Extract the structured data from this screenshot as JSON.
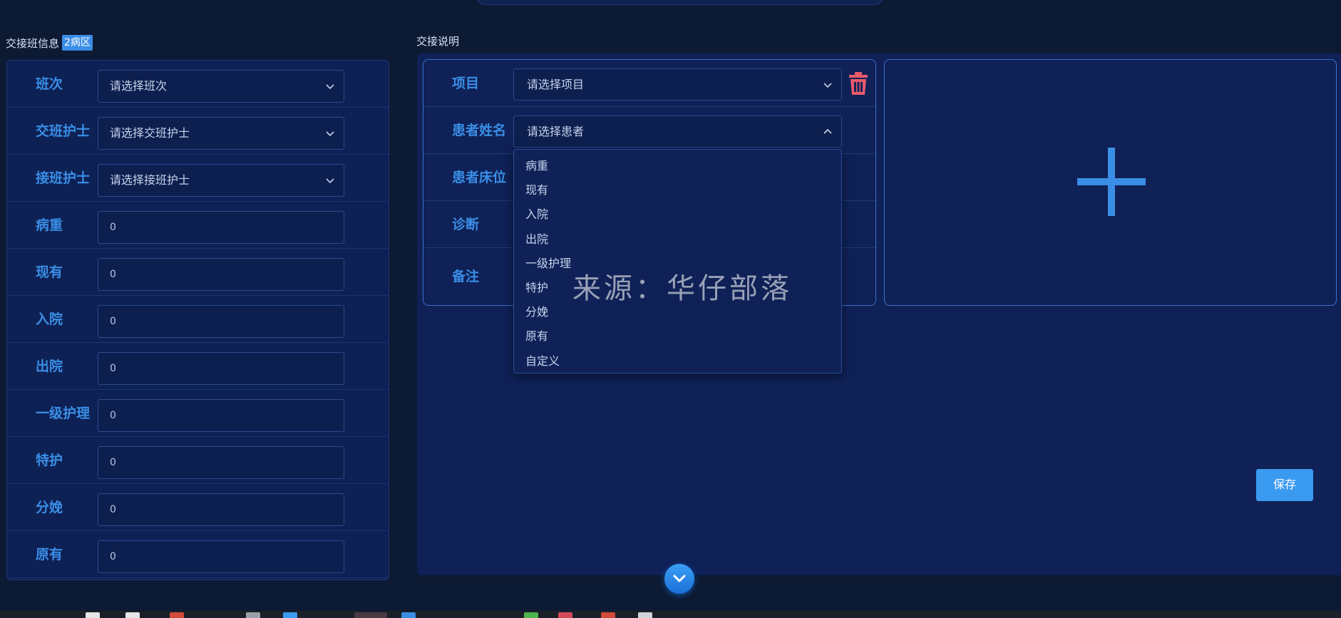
{
  "left": {
    "title": "交接班信息",
    "badge": "2病区",
    "rows": [
      {
        "label": "班次",
        "type": "select",
        "value": "请选择班次"
      },
      {
        "label": "交班护士",
        "type": "select",
        "value": "请选择交班护士"
      },
      {
        "label": "接班护士",
        "type": "select",
        "value": "请选择接班护士"
      },
      {
        "label": "病重",
        "type": "input",
        "value": "0"
      },
      {
        "label": "现有",
        "type": "input",
        "value": "0"
      },
      {
        "label": "入院",
        "type": "input",
        "value": "0"
      },
      {
        "label": "出院",
        "type": "input",
        "value": "0"
      },
      {
        "label": "一级护理",
        "type": "input",
        "value": "0"
      },
      {
        "label": "特护",
        "type": "input",
        "value": "0"
      },
      {
        "label": "分娩",
        "type": "input",
        "value": "0"
      },
      {
        "label": "原有",
        "type": "input",
        "value": "0"
      }
    ]
  },
  "right": {
    "title": "交接说明",
    "rows": [
      {
        "label": "项目",
        "value": "请选择项目"
      },
      {
        "label": "患者姓名",
        "value": "请选择患者"
      },
      {
        "label": "患者床位",
        "value": ""
      },
      {
        "label": "诊断",
        "value": ""
      },
      {
        "label": "备注",
        "value": ""
      }
    ],
    "dropdown_options": [
      "病重",
      "现有",
      "入院",
      "出院",
      "一级护理",
      "特护",
      "分娩",
      "原有",
      "自定义"
    ],
    "save_label": "保存"
  },
  "watermark": "来源：华仔部落",
  "colors": {
    "accent": "#3a8ee6",
    "panel": "#0f2157",
    "background": "#0d1a33",
    "delete": "#e85a6a"
  }
}
